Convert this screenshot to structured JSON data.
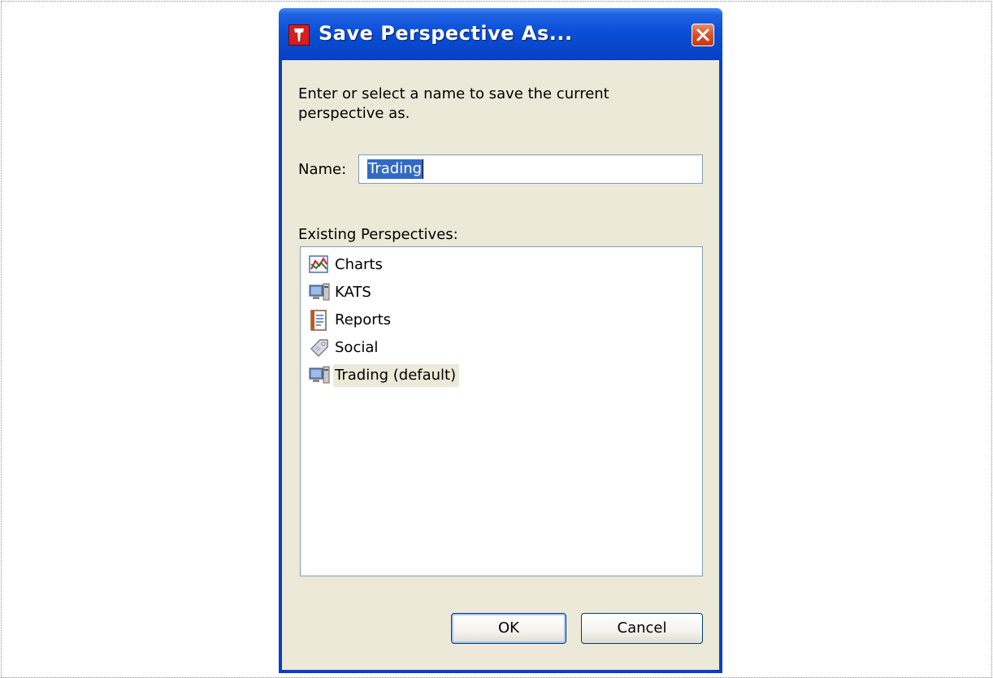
{
  "dialog": {
    "title": "Save Perspective As...",
    "prompt": "Enter or select a name to save the current perspective as.",
    "name_label": "Name:",
    "name_value": "Trading",
    "existing_label": "Existing Perspectives:",
    "perspectives": [
      {
        "label": "Charts",
        "icon": "chart-icon",
        "selected": false
      },
      {
        "label": "KATS",
        "icon": "computer-icon",
        "selected": false
      },
      {
        "label": "Reports",
        "icon": "report-icon",
        "selected": false
      },
      {
        "label": "Social",
        "icon": "tag-icon",
        "selected": false
      },
      {
        "label": "Trading (default)",
        "icon": "computer-icon",
        "selected": true
      }
    ],
    "ok_label": "OK",
    "cancel_label": "Cancel"
  },
  "colors": {
    "titlebar": "#0a4fd6",
    "client": "#ece9d8",
    "selection": "#316ac5",
    "close": "#d8502a"
  }
}
